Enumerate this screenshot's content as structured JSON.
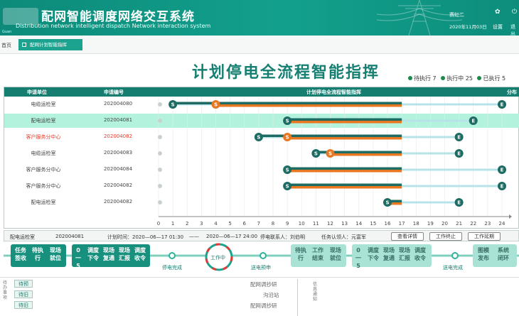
{
  "header": {
    "title": "配网智能调度网络交互系统",
    "subtitle": "Distribution network intelligent dispatch Network interaction system",
    "user": "赛虹二",
    "date": "2020年11月03日",
    "setting_label": "设置",
    "exit_label": "退出",
    "frag": "Guan"
  },
  "tabs": {
    "home": "首页",
    "active": "配网计划智能指挥"
  },
  "page": {
    "title": "计划停电全流程智能指挥",
    "stats": [
      {
        "label": "待执行",
        "count": "7"
      },
      {
        "label": "执行中",
        "count": "25"
      },
      {
        "label": "已执行",
        "count": "5"
      }
    ]
  },
  "table": {
    "headers": {
      "unit": "申请单位",
      "code": "申请编号",
      "chart": "计划停电全流程智能指挥",
      "extra": "分布"
    },
    "rows": [
      {
        "unit": "电缆运检室",
        "code": "202004080",
        "prefix": "",
        "red": false,
        "highlight": false
      },
      {
        "unit": "配电运检室",
        "code": "202004081",
        "prefix": "",
        "red": false,
        "highlight": true
      },
      {
        "unit": "客户服务分中心",
        "code": "202004082",
        "prefix": "",
        "red": true,
        "highlight": false
      },
      {
        "unit": "电缆运检室",
        "code": "202004083",
        "prefix": "",
        "red": false,
        "highlight": false
      },
      {
        "unit": "客户服务分中心",
        "code": "202004084",
        "prefix": "",
        "red": false,
        "highlight": false
      },
      {
        "unit": "客户服务分中心",
        "code": "202004082",
        "prefix": "",
        "red": false,
        "highlight": false
      },
      {
        "unit": "配电运检室",
        "code": "202004082",
        "prefix": "",
        "red": false,
        "highlight": false
      }
    ]
  },
  "chart_data": {
    "type": "gantt",
    "xlim": [
      0,
      24
    ],
    "ticks": [
      0,
      1,
      2,
      3,
      4,
      5,
      6,
      7,
      8,
      9,
      10,
      11,
      12,
      13,
      14,
      15,
      16,
      17,
      18,
      19,
      20,
      21,
      22,
      23,
      24
    ],
    "rows": [
      {
        "start": 1,
        "mid": 4,
        "end": 24,
        "solid_end": 17
      },
      {
        "start": 9,
        "mid": 9,
        "end": 22,
        "solid_end": 17
      },
      {
        "start": 7,
        "mid": 9,
        "end": 21,
        "solid_end": 17
      },
      {
        "start": 11,
        "mid": 12,
        "end": 21,
        "solid_end": 17
      },
      {
        "start": 9,
        "mid": 9,
        "end": 24,
        "solid_end": 17
      },
      {
        "start": 9,
        "mid": 9,
        "end": 24,
        "solid_end": 17
      },
      {
        "start": 16,
        "mid": 16,
        "end": 21,
        "solid_end": 17
      }
    ]
  },
  "details": {
    "unit": "配电运检室",
    "code": "202004081",
    "time_label": "计划时间：2020—06—17 01:30",
    "time_end": "2020—06—17 24:00",
    "contact": "停电联系人：刘伯明",
    "acceptor": "任务认领人：元富军",
    "btn_view": "查看详情",
    "btn_stop": "工作终止",
    "btn_delay": "工作延期"
  },
  "flow": {
    "group1": [
      "任务签收",
      "待执行",
      "现场就位"
    ],
    "group2_num": "0一5",
    "group2": [
      "调度下令",
      "现场复通",
      "现场汇报",
      "调度收令"
    ],
    "node1": "停电完成",
    "center": "工作中",
    "node2": "送电预申",
    "group3": [
      "待执行",
      "工作结束",
      "现场就位"
    ],
    "group4_num": "0一5",
    "group4": [
      "调度下令",
      "现场复通",
      "现场汇报",
      "调度收令"
    ],
    "node3": "送电完成",
    "group5": [
      "图模发布",
      "系统闭环"
    ]
  },
  "bottom": {
    "label_left": "待办事项",
    "items": [
      "待预",
      "待旧",
      "待旧"
    ],
    "texts": [
      "配网调抄研",
      "沟沿站",
      "配网调抄研"
    ],
    "label_right": "信息通知"
  }
}
